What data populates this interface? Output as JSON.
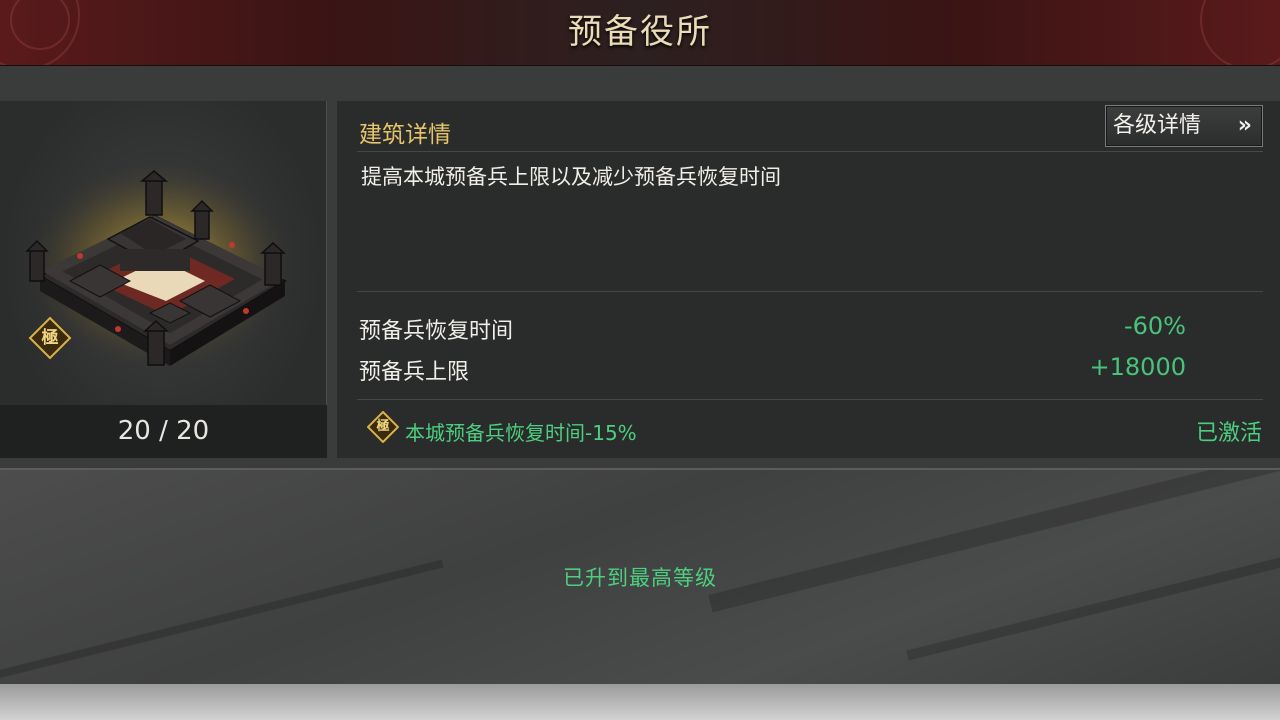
{
  "header": {
    "title": "预备役所"
  },
  "building": {
    "grade_badge": "極",
    "level_text": "20 / 20"
  },
  "details": {
    "section_title": "建筑详情",
    "level_details_button": "各级详情",
    "level_details_icon": "double-chevron-right-icon",
    "description": "提高本城预备兵上限以及减少预备兵恢复时间",
    "stats": [
      {
        "label": "预备兵恢复时间",
        "value": "-60%"
      },
      {
        "label": "预备兵上限",
        "value": "+18000"
      }
    ],
    "bonus": {
      "badge": "極",
      "text": "本城预备兵恢复时间-15%",
      "status": "已激活"
    }
  },
  "footer_status": "已升到最高等级",
  "colors": {
    "accent_gold": "#e6c46a",
    "positive_green": "#48c47a",
    "title_bar": "#3b1414",
    "panel": "#2a2b2b"
  }
}
